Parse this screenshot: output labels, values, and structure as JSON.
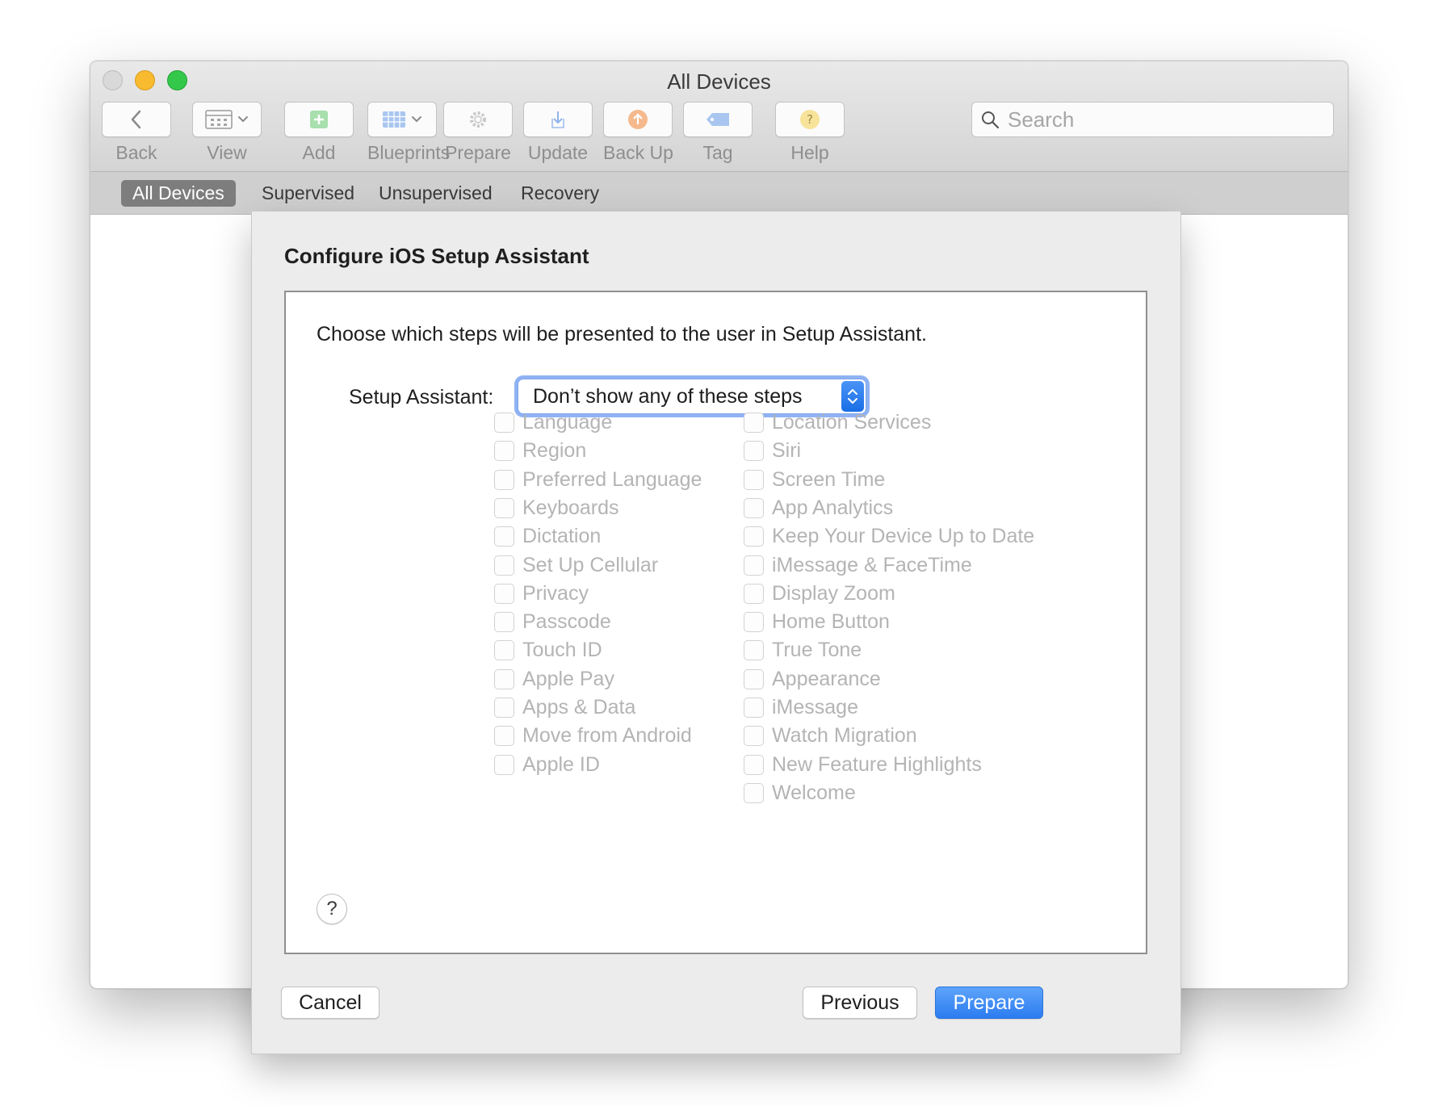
{
  "window": {
    "title": "All Devices"
  },
  "toolbar": {
    "back": "Back",
    "view": "View",
    "add": "Add",
    "blueprints": "Blueprints",
    "prepare": "Prepare",
    "update": "Update",
    "backup": "Back Up",
    "tag": "Tag",
    "help": "Help",
    "search_placeholder": "Search"
  },
  "scope_bar": {
    "all_devices": "All Devices",
    "supervised": "Supervised",
    "unsupervised": "Unsupervised",
    "recovery": "Recovery",
    "selected": "All Devices"
  },
  "sheet": {
    "title": "Configure iOS Setup Assistant",
    "instructions": "Choose which steps will be presented to the user in Setup Assistant.",
    "setup_assistant_label": "Setup Assistant:",
    "setup_assistant_value": "Don’t show any of these steps",
    "help": "?",
    "steps_left": [
      {
        "label": "Language",
        "checked": false
      },
      {
        "label": "Region",
        "checked": false
      },
      {
        "label": "Preferred Language",
        "checked": false
      },
      {
        "label": "Keyboards",
        "checked": false
      },
      {
        "label": "Dictation",
        "checked": false
      },
      {
        "label": "Set Up Cellular",
        "checked": false
      },
      {
        "label": "Privacy",
        "checked": false
      },
      {
        "label": "Passcode",
        "checked": false
      },
      {
        "label": "Touch ID",
        "checked": false
      },
      {
        "label": "Apple Pay",
        "checked": false
      },
      {
        "label": "Apps & Data",
        "checked": false
      },
      {
        "label": "Move from Android",
        "checked": false
      },
      {
        "label": "Apple ID",
        "checked": false
      }
    ],
    "steps_right": [
      {
        "label": "Location Services",
        "checked": false
      },
      {
        "label": "Siri",
        "checked": false
      },
      {
        "label": "Screen Time",
        "checked": false
      },
      {
        "label": "App Analytics",
        "checked": false
      },
      {
        "label": "Keep Your Device Up to Date",
        "checked": false
      },
      {
        "label": "iMessage & FaceTime",
        "checked": false
      },
      {
        "label": "Display Zoom",
        "checked": false
      },
      {
        "label": "Home Button",
        "checked": false
      },
      {
        "label": "True Tone",
        "checked": false
      },
      {
        "label": "Appearance",
        "checked": false
      },
      {
        "label": "iMessage",
        "checked": false
      },
      {
        "label": "Watch Migration",
        "checked": false
      },
      {
        "label": "New Feature Highlights",
        "checked": false
      },
      {
        "label": "Welcome",
        "checked": false
      }
    ],
    "buttons": {
      "cancel": "Cancel",
      "previous": "Previous",
      "prepare": "Prepare"
    }
  },
  "colors": {
    "accent": "#2c7cf1",
    "disabled_text": "#b4b4b4",
    "scope_selected": "#7d7d7d"
  },
  "icons": {
    "back": "chevron-left-icon",
    "view": "grid-view-icon",
    "add": "plus-icon",
    "blueprints": "blueprint-grid-icon",
    "prepare": "gear-icon",
    "update": "download-arrow-icon",
    "backup": "upload-arrow-circle-icon",
    "tag": "tag-icon",
    "help": "question-icon",
    "search": "search-icon"
  }
}
